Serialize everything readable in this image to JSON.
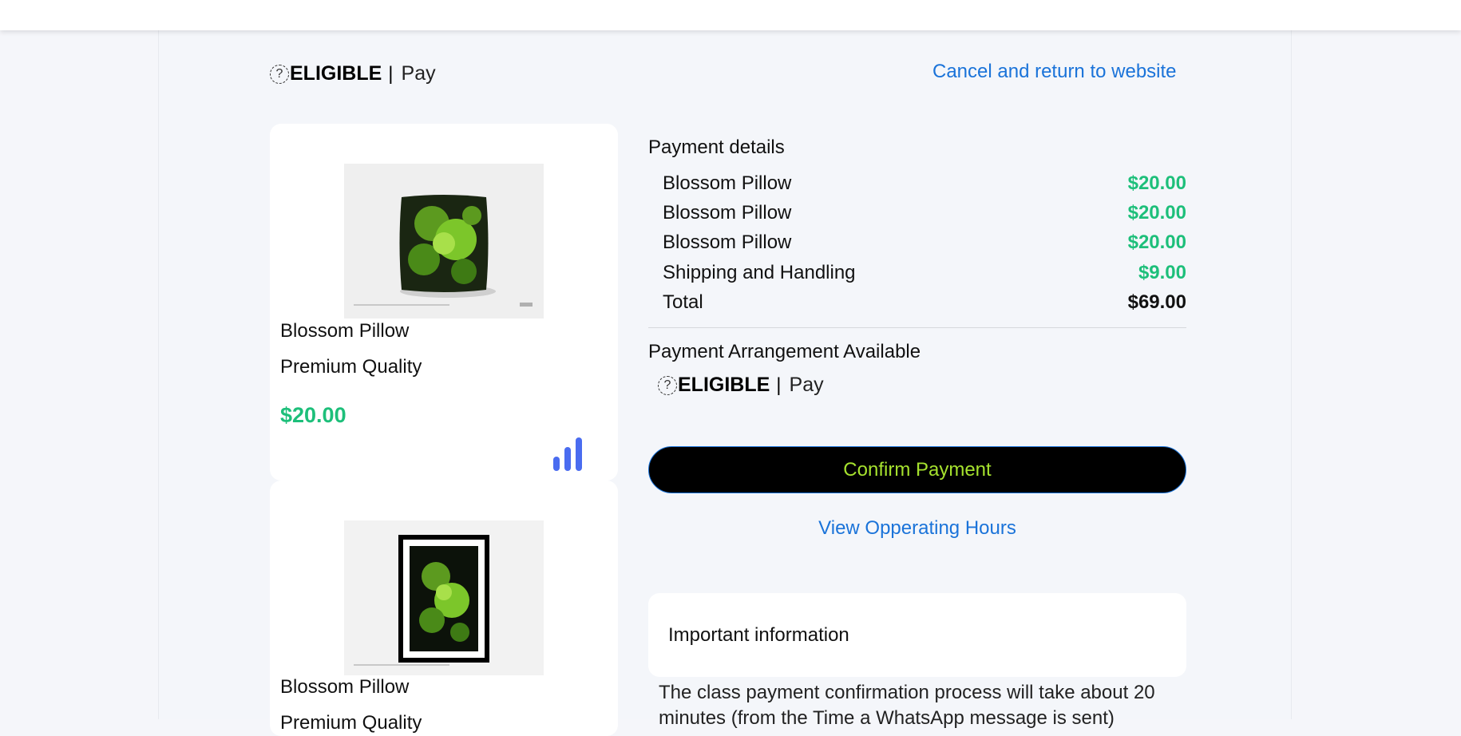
{
  "header": {
    "brand_name": "ELIGIBLE",
    "brand_separator": "|",
    "brand_pay": "Pay",
    "cancel_link": "Cancel and return to website"
  },
  "products": [
    {
      "name": "Blossom Pillow",
      "subtitle": "Premium Quality",
      "price": "$20.00",
      "image": "pillow-image"
    },
    {
      "name": "Blossom Pillow",
      "subtitle": "Premium Quality",
      "price": "",
      "image": "framed-print-image"
    }
  ],
  "payment_details": {
    "title": "Payment details",
    "items": [
      {
        "label": "Blossom Pillow",
        "amount": "$20.00"
      },
      {
        "label": "Blossom Pillow",
        "amount": "$20.00"
      },
      {
        "label": "Blossom Pillow",
        "amount": "$20.00"
      },
      {
        "label": "Shipping and Handling",
        "amount": "$9.00"
      }
    ],
    "total": {
      "label": "Total",
      "amount": "$69.00"
    }
  },
  "arrangement": {
    "title": "Payment Arrangement Available",
    "brand_name": "ELIGIBLE",
    "brand_separator": "|",
    "brand_pay": "Pay"
  },
  "actions": {
    "confirm_label": "Confirm Payment",
    "hours_link": "View Opperating Hours"
  },
  "info": {
    "title": "Important information",
    "text": "The class payment confirmation process will take about 20 minutes (from the Time a WhatsApp message is sent)"
  },
  "colors": {
    "accent_link": "#1a73d9",
    "price_green": "#1dbf7a",
    "confirm_text": "#a6e22e",
    "bars_icon": "#4a6cf0"
  },
  "icons": [
    "question-circle-icon",
    "signal-bars-icon"
  ]
}
